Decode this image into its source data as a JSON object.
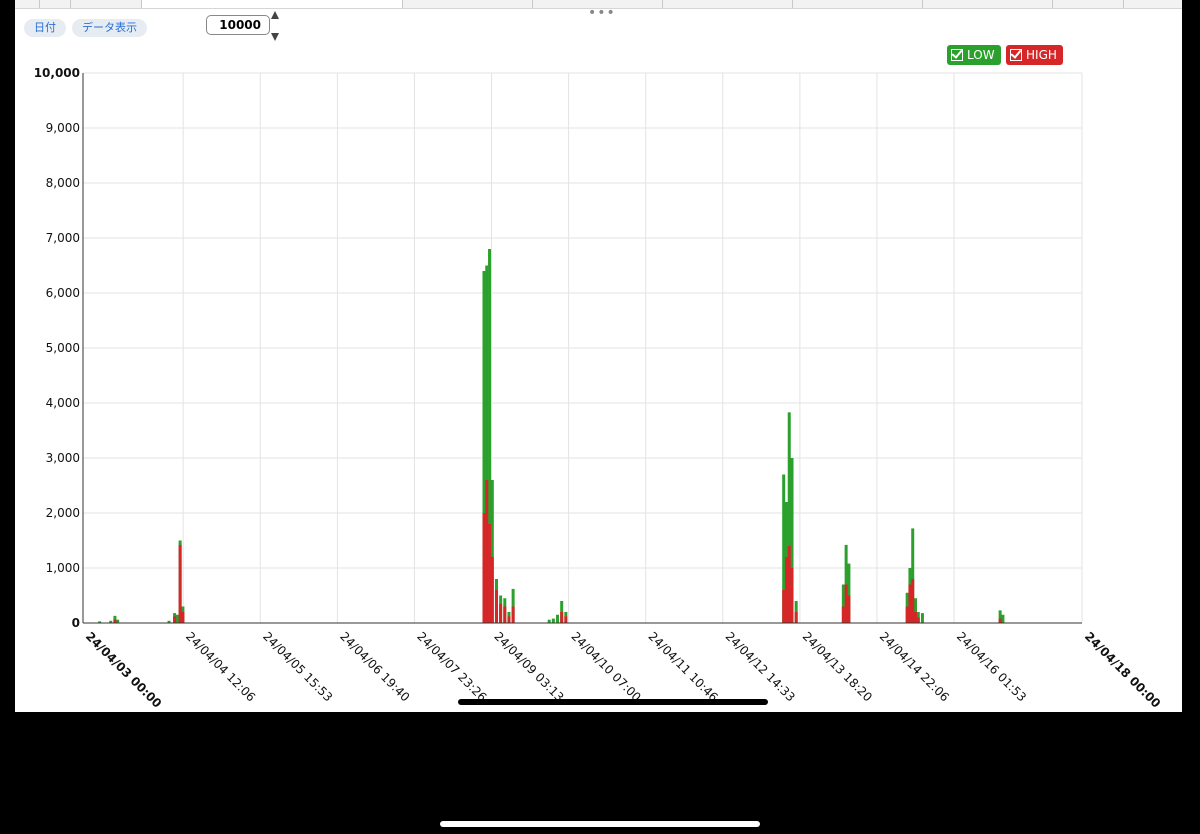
{
  "toolbar": {
    "date_label": "日付",
    "data_view_label": "データ表示",
    "limit_value": "10000"
  },
  "legend": {
    "low_label": "LOW",
    "high_label": "HIGH",
    "low_color": "#2ca02c",
    "high_color": "#d62728"
  },
  "chart_data": {
    "type": "bar",
    "title": "",
    "xlabel": "",
    "ylabel": "",
    "ylim": [
      0,
      10000
    ],
    "yticks": [
      "0",
      "1,000",
      "2,000",
      "3,000",
      "4,000",
      "5,000",
      "6,000",
      "7,000",
      "8,000",
      "9,000",
      "10,000"
    ],
    "xlim": [
      "24/04/03 00:00",
      "24/04/18 00:00"
    ],
    "xticks": [
      "24/04/03 00:00",
      "24/04/04 12:06",
      "24/04/05 15:53",
      "24/04/06 19:40",
      "24/04/07 23:26",
      "24/04/09 03:13",
      "24/04/10 07:00",
      "24/04/11 10:46",
      "24/04/12 14:33",
      "24/04/13 18:20",
      "24/04/14 22:06",
      "24/04/16 01:53",
      "24/04/18 00:00"
    ],
    "grid": true,
    "legend_position": "top-right",
    "series": [
      {
        "name": "LOW",
        "color": "#2ca02c",
        "points": [
          [
            "24/04/03 06:00",
            30
          ],
          [
            "24/04/03 10:00",
            40
          ],
          [
            "24/04/03 11:30",
            130
          ],
          [
            "24/04/03 12:30",
            60
          ],
          [
            "24/04/04 07:00",
            40
          ],
          [
            "24/04/04 09:00",
            180
          ],
          [
            "24/04/04 10:00",
            150
          ],
          [
            "24/04/04 11:00",
            1500
          ],
          [
            "24/04/04 12:00",
            300
          ],
          [
            "24/04/09 00:30",
            6400
          ],
          [
            "24/04/09 01:30",
            6500
          ],
          [
            "24/04/09 02:30",
            6800
          ],
          [
            "24/04/09 03:30",
            2600
          ],
          [
            "24/04/09 05:00",
            800
          ],
          [
            "24/04/09 06:30",
            500
          ],
          [
            "24/04/09 08:00",
            450
          ],
          [
            "24/04/09 09:30",
            200
          ],
          [
            "24/04/09 11:00",
            620
          ],
          [
            "24/04/10 00:00",
            60
          ],
          [
            "24/04/10 01:30",
            80
          ],
          [
            "24/04/10 03:00",
            150
          ],
          [
            "24/04/10 04:30",
            400
          ],
          [
            "24/04/10 06:00",
            200
          ],
          [
            "24/04/13 12:30",
            2700
          ],
          [
            "24/04/13 13:30",
            2200
          ],
          [
            "24/04/13 14:30",
            3830
          ],
          [
            "24/04/13 15:30",
            3000
          ],
          [
            "24/04/13 17:00",
            400
          ],
          [
            "24/04/14 10:00",
            700
          ],
          [
            "24/04/14 11:00",
            1420
          ],
          [
            "24/04/14 12:00",
            1080
          ],
          [
            "24/04/15 09:00",
            550
          ],
          [
            "24/04/15 10:00",
            1000
          ],
          [
            "24/04/15 11:00",
            1720
          ],
          [
            "24/04/15 12:00",
            450
          ],
          [
            "24/04/15 13:00",
            200
          ],
          [
            "24/04/15 14:30",
            180
          ],
          [
            "24/04/16 18:30",
            230
          ],
          [
            "24/04/16 19:30",
            150
          ]
        ]
      },
      {
        "name": "HIGH",
        "color": "#d62728",
        "points": [
          [
            "24/04/03 11:30",
            60
          ],
          [
            "24/04/04 09:00",
            120
          ],
          [
            "24/04/04 11:00",
            1420
          ],
          [
            "24/04/04 12:00",
            200
          ],
          [
            "24/04/09 00:30",
            2000
          ],
          [
            "24/04/09 01:30",
            2600
          ],
          [
            "24/04/09 02:30",
            1800
          ],
          [
            "24/04/09 03:30",
            1200
          ],
          [
            "24/04/09 05:00",
            600
          ],
          [
            "24/04/09 06:30",
            350
          ],
          [
            "24/04/09 08:00",
            300
          ],
          [
            "24/04/09 09:30",
            120
          ],
          [
            "24/04/09 11:00",
            300
          ],
          [
            "24/04/10 04:30",
            200
          ],
          [
            "24/04/10 06:00",
            120
          ],
          [
            "24/04/13 12:30",
            600
          ],
          [
            "24/04/13 13:30",
            1200
          ],
          [
            "24/04/13 14:30",
            1400
          ],
          [
            "24/04/13 15:30",
            1000
          ],
          [
            "24/04/13 17:00",
            200
          ],
          [
            "24/04/14 10:00",
            300
          ],
          [
            "24/04/14 11:00",
            700
          ],
          [
            "24/04/14 12:00",
            500
          ],
          [
            "24/04/15 09:00",
            300
          ],
          [
            "24/04/15 10:00",
            700
          ],
          [
            "24/04/15 11:00",
            800
          ],
          [
            "24/04/15 12:00",
            200
          ],
          [
            "24/04/15 13:00",
            100
          ],
          [
            "24/04/16 18:30",
            80
          ]
        ]
      }
    ]
  }
}
